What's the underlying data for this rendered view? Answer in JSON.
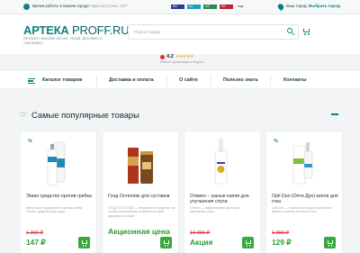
{
  "topbar": {
    "hours_label": "Время работы в вашем городе:",
    "hours_value": "Круглосуточно, 24/7",
    "langs": [
      "RU",
      "KZ",
      "UZ",
      "EN"
    ],
    "lang_extra": "еще",
    "city_label": "Ваш город:",
    "city_value": "Выбрать город"
  },
  "header": {
    "logo_main": "АРТЕКА",
    "logo_dot": " PROFF.RU",
    "tagline": "Интернет-магазин аптеки. Акции. Доставка и самовывоз.",
    "search_placeholder": "Поиск товара",
    "rating_value": "4.2",
    "rating_stars": "★★★★★",
    "rating_sub": "Рейтинг организации в Яндексе"
  },
  "nav": {
    "items": [
      "Каталог товаров",
      "Доставка и оплата",
      "О сайте",
      "Полезно знать",
      "Контакты"
    ]
  },
  "section": {
    "title": "Самые популярные товары"
  },
  "products": [
    {
      "badge": "%",
      "name": "Экзин средство против грибка",
      "desc": "Крем Экзин эффективно против грибка ногтей, средство для ухода",
      "old_price": "1 390 ₽",
      "price": "147 ₽"
    },
    {
      "badge": "",
      "name": "Голд Остеопак для суставов",
      "desc": "ГОЛД ОСТЕОПАК — натуральное средство на основе растительных компонентов для здоровья суставов",
      "old_price": "",
      "price": "",
      "promo": "Акционная цена"
    },
    {
      "badge": "",
      "name": "Отивен – ушные капли для улучшения слуха",
      "desc": "Отивен — эффективные капли для улучшения слуха",
      "old_price": "10 990 ₽",
      "price": "Акция"
    },
    {
      "badge": "%",
      "name": "Opti Duo (Опти Дуо) капли для глаз",
      "desc": "Opti Duo — глазные капли для улучшения зрения и снятия усталости глаз",
      "old_price": "1 990 ₽",
      "price": "129 ₽"
    }
  ],
  "colors": {
    "accent": "#0f7f83",
    "price_green": "#2d9b33",
    "old_price_red": "#d8312b"
  }
}
